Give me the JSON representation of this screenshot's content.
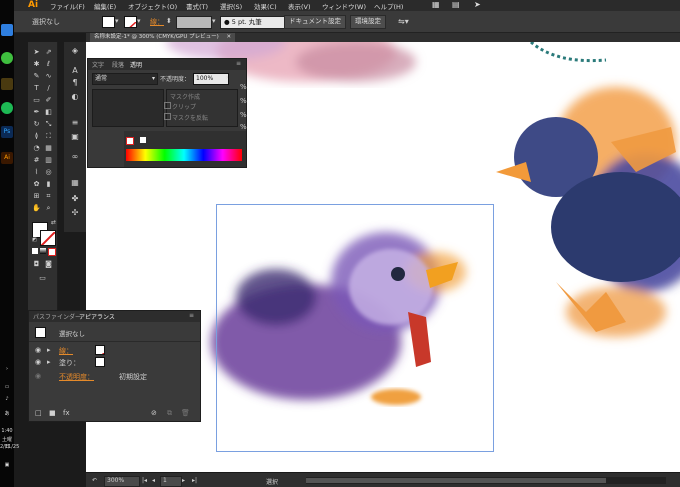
{
  "taskbar": {
    "clock": "1:40",
    "weekday": "土曜日",
    "date": "2/11/25"
  },
  "menubar": {
    "app_logo": "Ai",
    "items": [
      "ファイル(F)",
      "編集(E)",
      "オブジェクト(O)",
      "書式(T)",
      "選択(S)",
      "効果(C)",
      "表示(V)",
      "ウィンドウ(W)",
      "ヘルプ(H)"
    ]
  },
  "control_bar": {
    "selection_status": "選択なし",
    "stroke_label": "線：",
    "brush_value": "5 pt. 丸筆",
    "document_setup_button": "ドキュメント設定",
    "preferences_button": "環境設定"
  },
  "document_tab": {
    "title": "名称未設定-1* @ 300% (CMYK/GPU プレビュー)"
  },
  "transparency_panel": {
    "tabs": [
      "文字",
      "段落",
      "透明"
    ],
    "blend_mode": "通常",
    "opacity_label": "不透明度：",
    "opacity_value": "100%",
    "make_mask_button": "マスク作成",
    "clip_label": "クリップ",
    "invert_mask_label": "マスクを反転",
    "percent_symbol": "%"
  },
  "appearance_panel": {
    "tabs": [
      "パスファインダー",
      "アピアランス"
    ],
    "header": "選択なし",
    "rows": [
      {
        "label": "線：",
        "value": ""
      },
      {
        "label": "塗り：",
        "value": ""
      },
      {
        "label": "不透明度：",
        "value": "初期設定"
      }
    ]
  },
  "status_bar": {
    "zoom": "300%",
    "page": "1",
    "tool_status": "選択"
  },
  "colors": {
    "accent": "#ff9a00",
    "panel_bg": "#393939",
    "canvas": "#ffffff",
    "artboard_border": "#7aa0e0",
    "link_orange": "#e58a2a"
  }
}
